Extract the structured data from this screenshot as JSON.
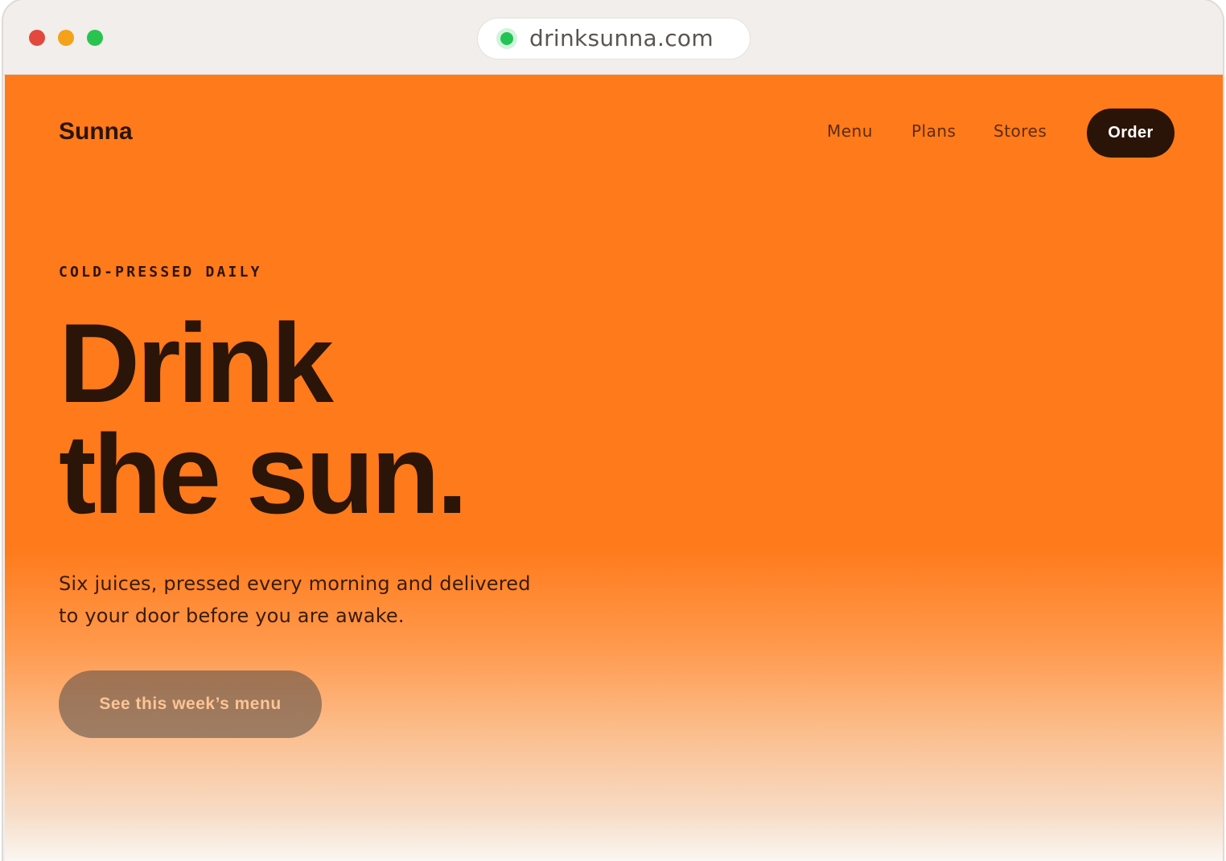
{
  "browser": {
    "url": "drinksunna.com",
    "traffic_lights": [
      "close",
      "minimize",
      "maximize"
    ],
    "status_icon": "secure-dot-icon"
  },
  "nav": {
    "brand": "Sunna",
    "links": [
      "Menu",
      "Plans",
      "Stores"
    ],
    "order_label": "Order"
  },
  "hero": {
    "eyebrow": "COLD-PRESSED DAILY",
    "headline_line1": "Drink",
    "headline_line2": "the sun.",
    "lede_line1": "Six juices, pressed every morning and delivered",
    "lede_line2": "to your door before you are awake.",
    "cta_label": "See this week’s menu"
  },
  "colors": {
    "brand_orange": "#ff7a1a",
    "ink": "#2b1408",
    "order_button": "#2a1408"
  }
}
